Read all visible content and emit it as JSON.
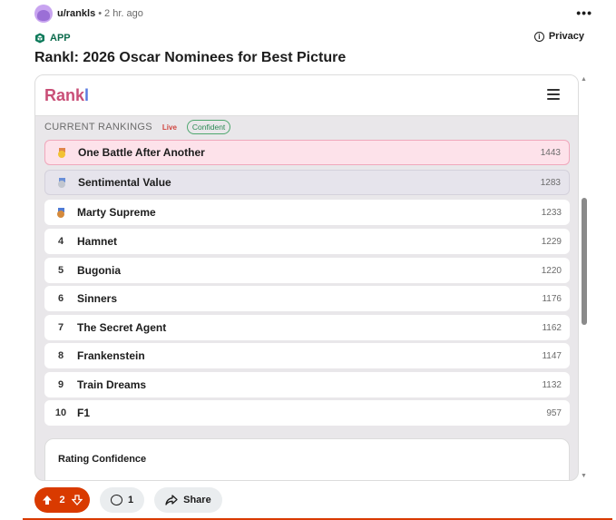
{
  "post": {
    "username": "u/rankls",
    "separator": "•",
    "time": "2 hr. ago",
    "more": "•••",
    "app_label": "APP",
    "privacy_label": "Privacy",
    "title": "Rankl: 2026 Oscar Nominees for Best Picture"
  },
  "app": {
    "logo_main": "Rank",
    "logo_accent": "l",
    "section_label": "CURRENT RANKINGS",
    "live_label": "Live",
    "confidence_badge": "Confident",
    "rankings": [
      {
        "pos": "",
        "medal": "gold",
        "title": "One Battle After Another",
        "score": "1443"
      },
      {
        "pos": "",
        "medal": "silver",
        "title": "Sentimental Value",
        "score": "1283"
      },
      {
        "pos": "",
        "medal": "bronze",
        "title": "Marty Supreme",
        "score": "1233"
      },
      {
        "pos": "4",
        "title": "Hamnet",
        "score": "1229"
      },
      {
        "pos": "5",
        "title": "Bugonia",
        "score": "1220"
      },
      {
        "pos": "6",
        "title": "Sinners",
        "score": "1176"
      },
      {
        "pos": "7",
        "title": "The Secret Agent",
        "score": "1162"
      },
      {
        "pos": "8",
        "title": "Frankenstein",
        "score": "1147"
      },
      {
        "pos": "9",
        "title": "Train Dreams",
        "score": "1132"
      },
      {
        "pos": "10",
        "title": "F1",
        "score": "957"
      }
    ],
    "confidence_card_title": "Rating Confidence"
  },
  "actions": {
    "votes": "2",
    "comments": "1",
    "share_label": "Share"
  },
  "colors": {
    "accent": "#d93a00",
    "logo_pink": "#c94f77",
    "logo_blue": "#5a7be0",
    "live_red": "#d0443e",
    "confident_green": "#2d8a56"
  }
}
